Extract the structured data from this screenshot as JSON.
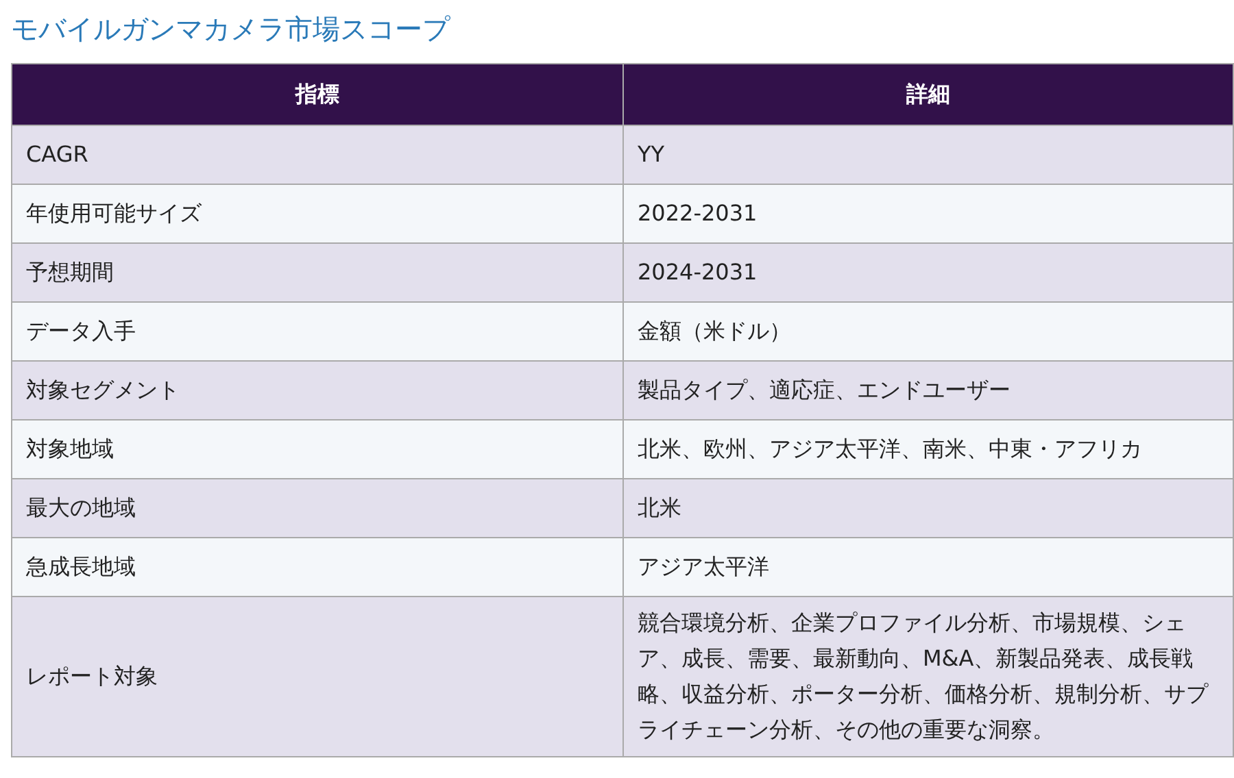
{
  "title": "モバイルガンマカメラ市場スコープ",
  "table": {
    "columns": [
      "指標",
      "詳細"
    ],
    "rows": [
      {
        "metric": "CAGR",
        "detail": "YY"
      },
      {
        "metric": "年使用可能サイズ",
        "detail": "2022-2031"
      },
      {
        "metric": "予想期間",
        "detail": "2024-2031"
      },
      {
        "metric": "データ入手",
        "detail": "金額（米ドル）"
      },
      {
        "metric": "対象セグメント",
        "detail": "製品タイプ、適応症、エンドユーザー"
      },
      {
        "metric": "対象地域",
        "detail": "北米、欧州、アジア太平洋、南米、中東・アフリカ"
      },
      {
        "metric": "最大の地域",
        "detail": "北米"
      },
      {
        "metric": "急成長地域",
        "detail": "アジア太平洋"
      },
      {
        "metric": "レポート対象",
        "detail": "競合環境分析、企業プロファイル分析、市場規模、シェア、成長、需要、最新動向、M&A、新製品発表、成長戦略、収益分析、ポーター分析、価格分析、規制分析、サプライチェーン分析、その他の重要な洞察。"
      }
    ]
  }
}
